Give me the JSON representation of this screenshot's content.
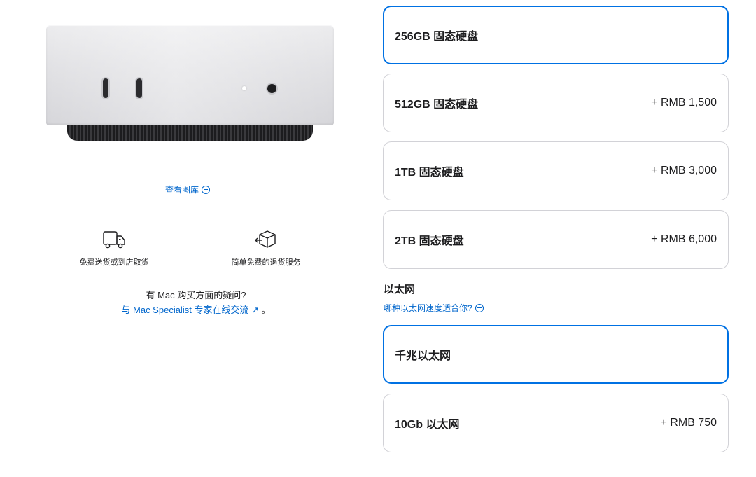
{
  "gallery": {
    "link_label": "查看图库"
  },
  "services": [
    {
      "icon": "delivery-truck-icon",
      "label": "免费送货或到店取货"
    },
    {
      "icon": "return-box-icon",
      "label": "简单免费的退货服务"
    }
  ],
  "help": {
    "question": "有 Mac 购买方面的疑问?",
    "link_prefix": "与 ",
    "link_text": "Mac Specialist 专家在线交流",
    "link_arrow": "↗",
    "link_suffix": " 。"
  },
  "storage": {
    "options": [
      {
        "name": "256GB 固态硬盘",
        "price": "",
        "selected": true
      },
      {
        "name": "512GB 固态硬盘",
        "price": "+ RMB 1,500",
        "selected": false
      },
      {
        "name": "1TB 固态硬盘",
        "price": "+ RMB 3,000",
        "selected": false
      },
      {
        "name": "2TB 固态硬盘",
        "price": "+ RMB 6,000",
        "selected": false
      }
    ]
  },
  "ethernet": {
    "title": "以太网",
    "help_link": "哪种以太网速度适合你?",
    "options": [
      {
        "name": "千兆以太网",
        "price": "",
        "selected": true
      },
      {
        "name": "10Gb 以太网",
        "price": "+ RMB 750",
        "selected": false
      }
    ]
  },
  "colors": {
    "accent": "#0071e3",
    "link": "#0066cc",
    "border": "#d2d2d7",
    "text": "#1d1d1f"
  }
}
